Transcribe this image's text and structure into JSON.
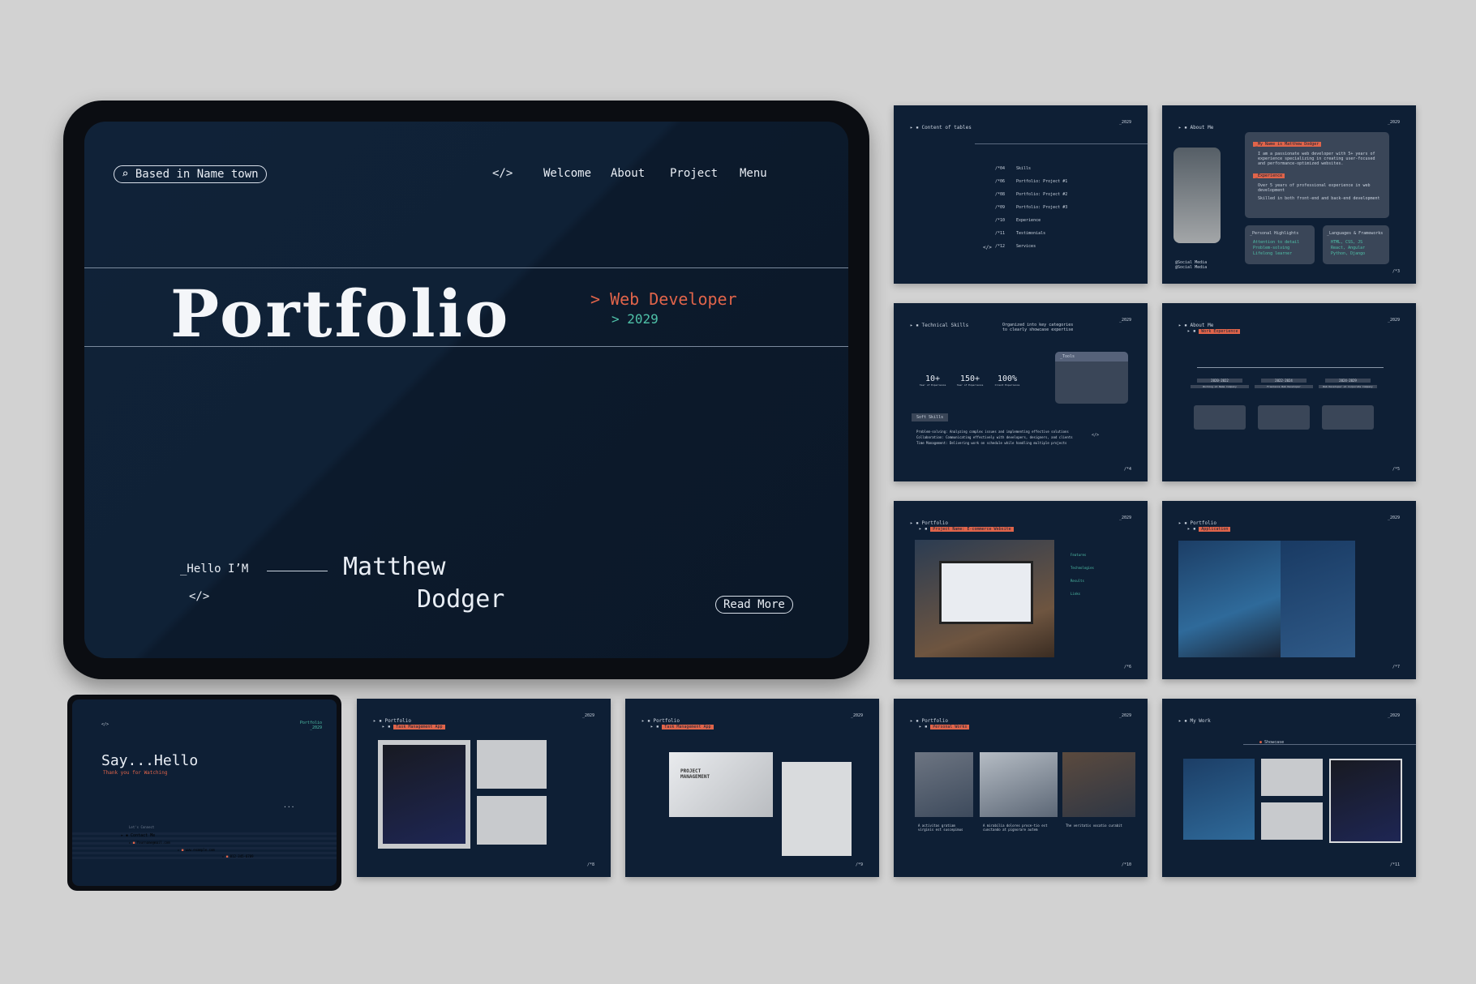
{
  "main_slide": {
    "location": "Based in Name town",
    "nav": {
      "code_icon": "</>",
      "welcome": "Welcome",
      "about": "About",
      "project": "Project",
      "menu": "Menu"
    },
    "title": "Portfolio",
    "role": "> Web Developer",
    "year": "> 2029",
    "hello": "_Hello I’M",
    "code_icon": "</>",
    "first_name": "Matthew",
    "last_name": "Dodger",
    "cta": "Read More"
  },
  "toc": {
    "crumb": "Content of tables",
    "year": "_2029",
    "items": [
      {
        "num": "/*04",
        "label": "Skills"
      },
      {
        "num": "/*06",
        "label": "Portfolio: Project #1"
      },
      {
        "num": "/*08",
        "label": "Portfolio: Project #2"
      },
      {
        "num": "/*09",
        "label": "Portfolio: Project #3"
      },
      {
        "num": "/*10",
        "label": "Experience"
      },
      {
        "num": "/*11",
        "label": "Testimonials"
      },
      {
        "num": "/*12",
        "label": "Services"
      }
    ],
    "code": "</>"
  },
  "about1": {
    "crumb": "About Me",
    "year": "_2029",
    "tag1": "_My Name is Matthew Dodger",
    "text1": "I am a passionate web developer with 5+ years of experience specializing in creating user-focused and performance-optimized websites.",
    "tag2": "_Experience",
    "text2": "Over 5 years of professional experience in web development",
    "text3": "Skilled in both front-end and back-end development",
    "box1_title": "_Personal Highlights",
    "box1_items": [
      "Attention to detail",
      "Problem-solving",
      "Lifelong learner"
    ],
    "box2_title": "_Languages & Frameworks",
    "box2_items": [
      "HTML, CSS, JS",
      "React, Angular",
      "Python, Django"
    ],
    "social1": "@Social Media",
    "social2": "@Social Media",
    "page": "/*3"
  },
  "skills": {
    "crumb": "Technical Skills",
    "year": "_2029",
    "intro": "Organized into key categories to clearly showcase expertise",
    "stats": [
      {
        "value": "10+",
        "label": "Year of Experience"
      },
      {
        "value": "150+",
        "label": "Year of Experience"
      },
      {
        "value": "100%",
        "label": "Client Experience"
      }
    ],
    "tools_title": "_Tools",
    "soft_title": "Soft Skills",
    "soft_items": [
      "Problem-solving: Analyzing complex issues and implementing effective solutions",
      "Collaboration: Communicating effectively with developers, designers, and clients",
      "Time Management: Delivering work on schedule while handling multiple projects"
    ],
    "code": "</>",
    "page": "/*4"
  },
  "experience": {
    "crumb": "About Me",
    "tag": "Work Experience",
    "year": "_2029",
    "years": [
      "2020-2022",
      "2022-2024",
      "2024-2029"
    ],
    "roles": [
      "Working at Name Company",
      "Freelance Web Developer",
      "Web Developer at Corporate Company"
    ],
    "page": "/*5"
  },
  "project1": {
    "crumb": "Portfolio",
    "tag": "Project Name: E-commerce Website",
    "year": "_2029",
    "sections": [
      "Features",
      "Technologies",
      "Results",
      "Links"
    ],
    "page": "/*6"
  },
  "project2": {
    "crumb": "Portfolio",
    "tag": "Application",
    "year": "_2029",
    "page": "/*7"
  },
  "contact": {
    "code": "</>",
    "crumb": "Portfolio",
    "year": "_2029",
    "title": "Say...Hello",
    "subtitle": "Thank you for Watching",
    "lets": "Let's Connect",
    "contact_me": "Contact Me",
    "email": "Yourname@mail.com",
    "web": "www.example.com",
    "phone": "012-345-6789",
    "dots": "..."
  },
  "project3": {
    "crumb": "Portfolio",
    "tag": "Task Management App",
    "year": "_2029",
    "page": "/*8"
  },
  "project4": {
    "crumb": "Portfolio",
    "tag": "Task Management App",
    "year": "_2029",
    "header": "PROJECT MANAGEMENT",
    "page": "/*9"
  },
  "project5": {
    "crumb": "Portfolio",
    "tag": "Personal Works",
    "year": "_2029",
    "captions": [
      "A activitas gratiam virginis est suscepimus",
      "A mirabilia dolores proce-tio est cunctando at pignorare autem",
      "The veritatis vocatio curabit"
    ],
    "page": "/*10"
  },
  "mywork": {
    "crumb": "My Work",
    "year": "_2029",
    "tag": "Showcase",
    "page": "/*11"
  }
}
